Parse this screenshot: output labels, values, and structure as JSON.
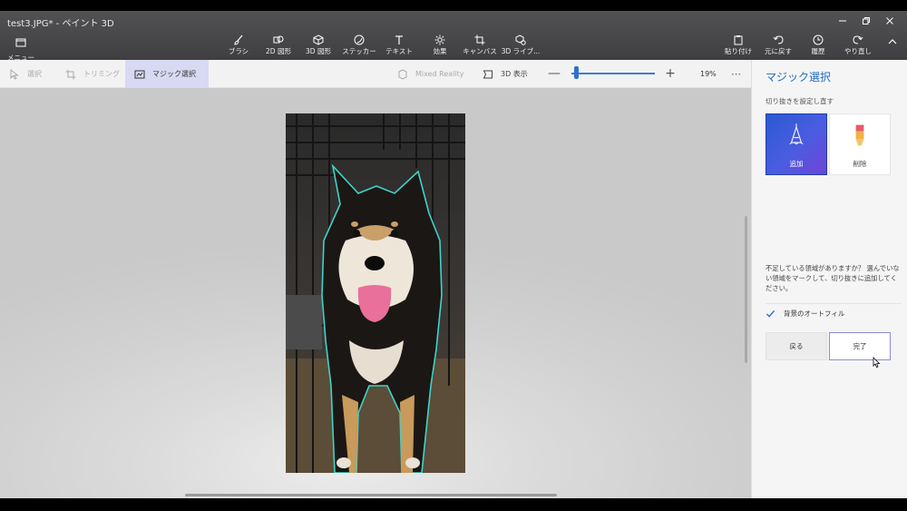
{
  "window": {
    "title": "test3.JPG* - ペイント 3D"
  },
  "ribbon": {
    "menu_label": "メニュー",
    "tools": [
      {
        "label": "ブラシ",
        "icon": "brush-icon"
      },
      {
        "label": "2D 図形",
        "icon": "2d-shapes-icon"
      },
      {
        "label": "3D 図形",
        "icon": "3d-shapes-icon"
      },
      {
        "label": "ステッカー",
        "icon": "sticker-icon"
      },
      {
        "label": "テキスト",
        "icon": "text-icon"
      },
      {
        "label": "効果",
        "icon": "effects-icon"
      },
      {
        "label": "キャンバス",
        "icon": "canvas-icon"
      },
      {
        "label": "3D ライブ...",
        "icon": "3d-library-icon"
      }
    ],
    "right": [
      {
        "label": "貼り付け",
        "icon": "paste-icon"
      },
      {
        "label": "元に戻す",
        "icon": "undo-icon"
      },
      {
        "label": "履歴",
        "icon": "history-icon"
      },
      {
        "label": "やり直し",
        "icon": "redo-icon"
      }
    ]
  },
  "subtoolbar": {
    "select_label": "選択",
    "crop_label": "トリミング",
    "magic_select_label": "マジック選択",
    "mixed_reality_label": "Mixed Reality",
    "view_3d_label": "3D 表示",
    "zoom_minus": "—",
    "zoom_plus": "+",
    "zoom_level": 0.19,
    "zoom_text": "19%",
    "more": "⋯"
  },
  "panel": {
    "title": "マジック選択",
    "subtitle": "切り抜きを設定し直す",
    "add_label": "追加",
    "delete_label": "削除",
    "hint": "不足している領域がありますか？ 選んでいない領域をマークして、切り抜きに追加してください。",
    "autofill_label": "背景のオートフィル",
    "autofill_checked": true,
    "back_label": "戻る",
    "done_label": "完了"
  },
  "colors": {
    "accent": "#1d6bc0",
    "ribbon_bg": "#4a4a4d",
    "selected_tab": "#d8d9f3"
  }
}
